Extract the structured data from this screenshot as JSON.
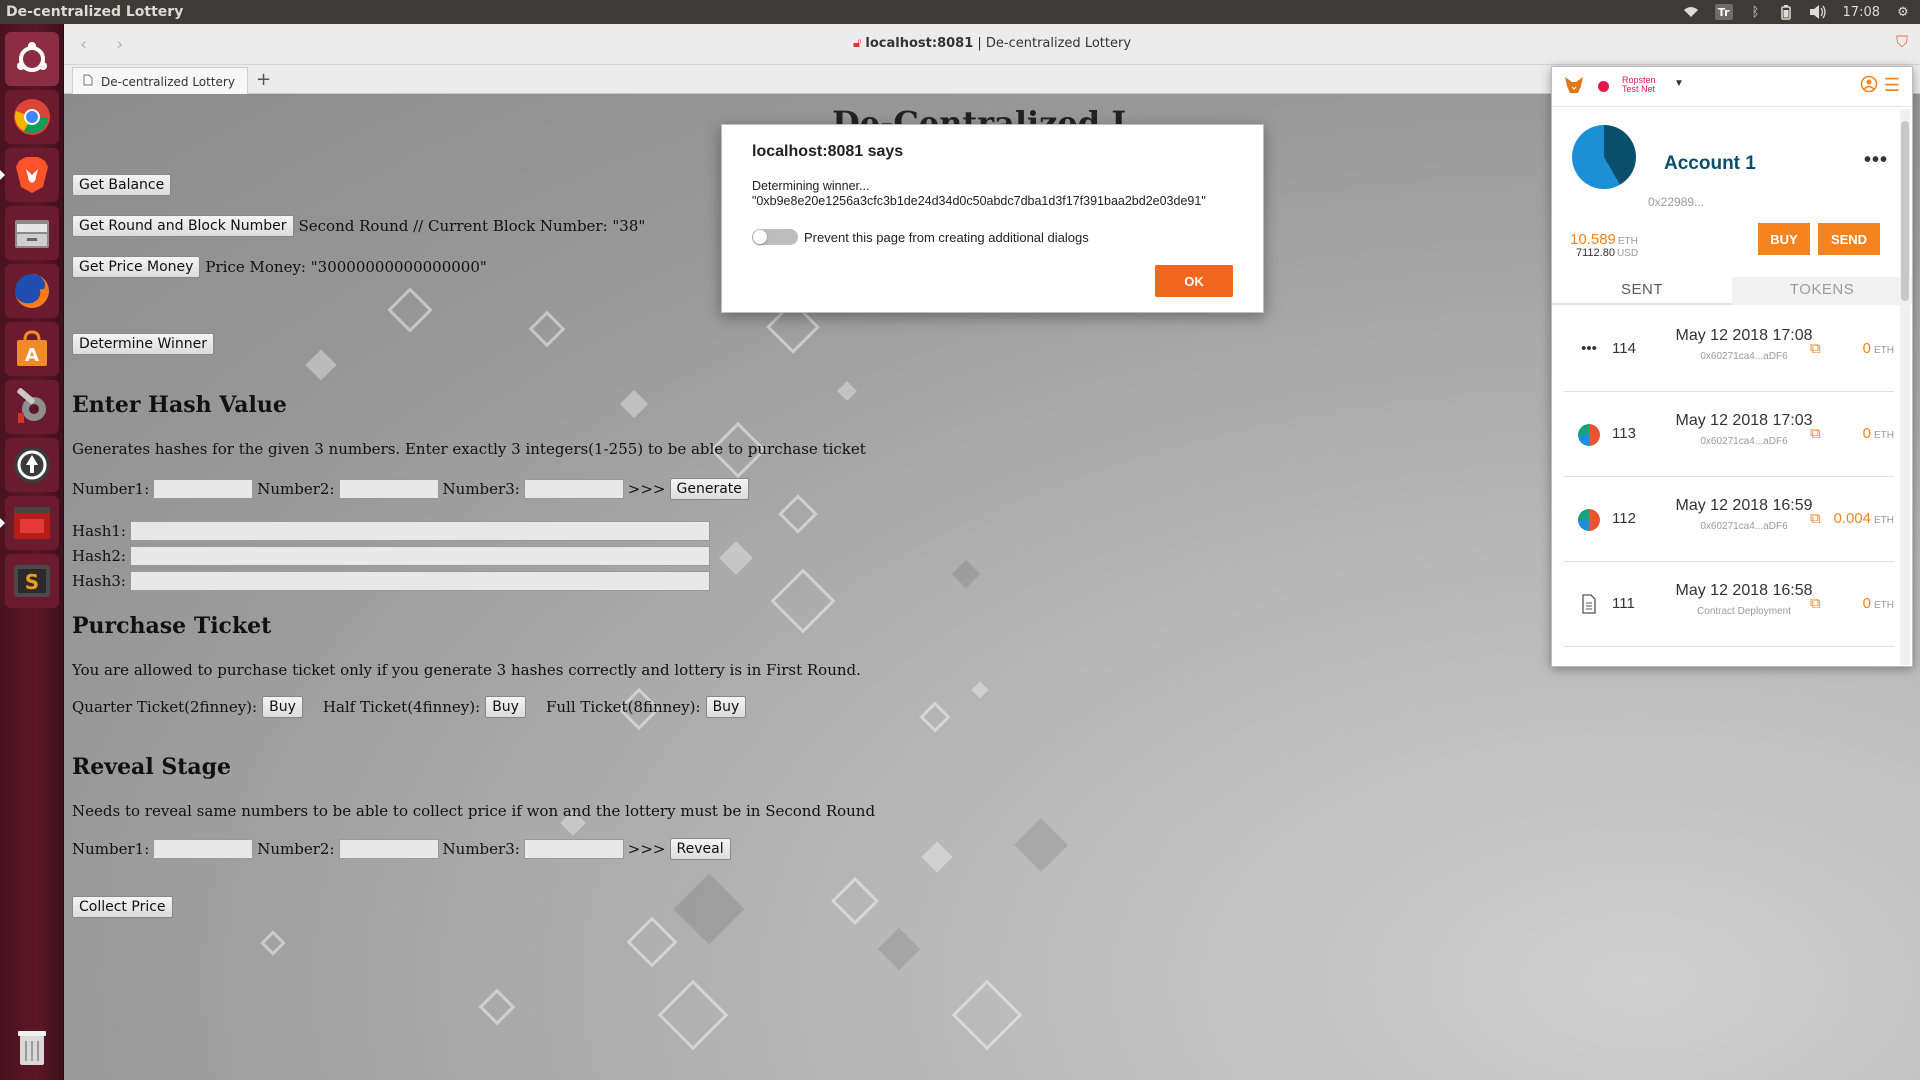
{
  "topbar": {
    "app_title": "De-centralized Lottery",
    "tr_badge": "Tr",
    "clock": "17:08"
  },
  "browser": {
    "url_host": "localhost:8081",
    "url_rest": " | De-centralized Lottery",
    "tab_title": "De-centralized Lottery",
    "new_tab": "+"
  },
  "page": {
    "title": "De-Centralized L",
    "get_balance": "Get Balance",
    "get_round": "Get Round and Block Number",
    "round_text": "Second Round // Current Block Number: \"38\"",
    "get_price": "Get Price Money",
    "price_text": "Price Money: \"30000000000000000\"",
    "determine": "Determine Winner",
    "hash_heading": "Enter Hash Value",
    "hash_desc": "Generates hashes for the given 3 numbers. Enter exactly 3 integers(1-255) to be able to purchase ticket",
    "number1": "Number1:",
    "number2": "Number2:",
    "number3": "Number3:",
    "arrows": ">>>",
    "generate": "Generate",
    "hash1": "Hash1:",
    "hash2": "Hash2:",
    "hash3": "Hash3:",
    "purchase_heading": "Purchase Ticket",
    "purchase_desc": "You are allowed to purchase ticket only if you generate 3 hashes correctly and lottery is in First Round.",
    "quarter": "Quarter Ticket(2finney):",
    "half": "Half Ticket(4finney):",
    "full": "Full Ticket(8finney):",
    "buy": "Buy",
    "reveal_heading": "Reveal Stage",
    "reveal_desc": "Needs to reveal same numbers to be able to collect price if won and the lottery must be in Second Round",
    "reveal": "Reveal",
    "collect": "Collect Price"
  },
  "alert": {
    "heading": "localhost:8081 says",
    "line1": "Determining winner...",
    "line2": "\"0xb9e8e20e1256a3cfc3b1de24d34d0c50abdc7dba1d3f17f391baa2bd2e03de91\"",
    "toggle_label": "Prevent this page from creating additional dialogs",
    "ok": "OK"
  },
  "metamask": {
    "network_line1": "Ropsten",
    "network_line2": "Test Net",
    "account_name": "Account 1",
    "menu_dots": "•••",
    "address": "0x22989...",
    "balance": "10.589",
    "balance_unit": "ETH",
    "usd": "7112.80",
    "usd_unit": "USD",
    "buy": "BUY",
    "send": "SEND",
    "tab_sent": "SENT",
    "tab_tokens": "TOKENS",
    "transactions": [
      {
        "nonce": "114",
        "date": "May 12 2018 17:08",
        "sub": "0x60271ca4...aDF6",
        "amount": "0",
        "unit": "ETH",
        "icon": "pending-dots-icon"
      },
      {
        "nonce": "113",
        "date": "May 12 2018 17:03",
        "sub": "0x60271ca4...aDF6",
        "amount": "0",
        "unit": "ETH",
        "icon": "identicon-icon"
      },
      {
        "nonce": "112",
        "date": "May 12 2018 16:59",
        "sub": "0x60271ca4...aDF6",
        "amount": "0.004",
        "unit": "ETH",
        "icon": "identicon-icon"
      },
      {
        "nonce": "111",
        "date": "May 12 2018 16:58",
        "sub": "Contract Deployment",
        "amount": "0",
        "unit": "ETH",
        "icon": "document-icon"
      }
    ]
  },
  "colors": {
    "accent": "#f5841f",
    "ok_button": "#f3661f",
    "network": "#e91550",
    "account": "#0b4f6c"
  }
}
